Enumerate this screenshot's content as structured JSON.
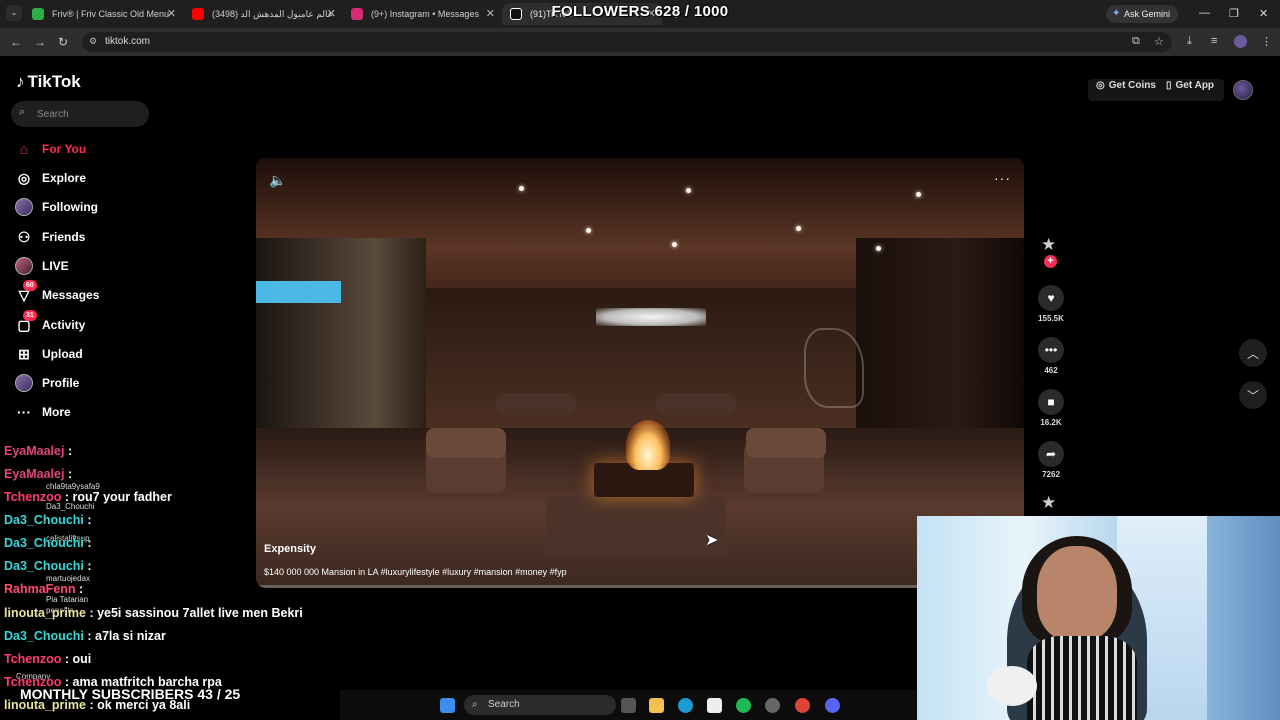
{
  "browser": {
    "tabs": [
      {
        "title": "Friv® | Friv Classic Old Menu",
        "close": "✕",
        "color": "#2fae46"
      },
      {
        "title": "عالم عاميول المدهش الد (3498)",
        "close": "✕",
        "color": "#ff0000"
      },
      {
        "title": "(9+) Instagram • Messages",
        "close": "✕",
        "color": "#d62976"
      },
      {
        "title": "(91)TikTok",
        "close": "✕",
        "color": "#ffffff"
      }
    ],
    "new_tab": "+",
    "ask_gemini": "Ask Gemini",
    "url": "tiktok.com"
  },
  "overlay": {
    "followers": "FOLLOWERS 628 / 1000",
    "monthly_subs": "MONTHLY SUBSCRIBERS 43 / 25"
  },
  "tiktok": {
    "logo": "TikTok",
    "search_placeholder": "Search",
    "menu": [
      {
        "label": "For You",
        "icon": "home-icon",
        "glyph": "⌂"
      },
      {
        "label": "Explore",
        "icon": "compass-icon",
        "glyph": "◎"
      },
      {
        "label": "Following",
        "icon": "following-avatar-icon",
        "glyph": ""
      },
      {
        "label": "Friends",
        "icon": "friends-icon",
        "glyph": "👥"
      },
      {
        "label": "LIVE",
        "icon": "live-avatar-icon",
        "glyph": ""
      },
      {
        "label": "Messages",
        "icon": "messages-icon",
        "glyph": "▽",
        "badge": "60"
      },
      {
        "label": "Activity",
        "icon": "activity-icon",
        "glyph": "▢",
        "badge": "31"
      },
      {
        "label": "Upload",
        "icon": "upload-icon",
        "glyph": "⊞"
      },
      {
        "label": "Profile",
        "icon": "profile-avatar-icon",
        "glyph": ""
      },
      {
        "label": "More",
        "icon": "more-icon",
        "glyph": "···"
      }
    ],
    "get_coins": "Get Coins",
    "get_app": "Get App",
    "video": {
      "author": "Expensity",
      "caption": "$140 000 000 Mansion in LA #luxurylifestyle #luxury #mansion #money #fyp",
      "progress": 0.0
    },
    "actions": {
      "likes": "155.5K",
      "comments": "462",
      "saves": "16.2K",
      "shares": "7262"
    }
  },
  "chat": [
    {
      "user": "EyaMaalej",
      "msg": " : ",
      "color": "#e0457b"
    },
    {
      "user": "EyaMaalej",
      "msg": " : ",
      "color": "#e0457b"
    },
    {
      "user": "Tchenzoo",
      "msg": " : rou7 your fadher",
      "color": "#ff3c6e"
    },
    {
      "user": "Da3_Chouchi",
      "msg": " : ",
      "color": "#35d7d7"
    },
    {
      "user": "Da3_Chouchi",
      "msg": " : ",
      "color": "#35d7d7"
    },
    {
      "user": "Da3_Chouchi",
      "msg": " : ",
      "color": "#35d7d7"
    },
    {
      "user": "RahmaFenn",
      "msg": " : ",
      "color": "#ff4d6d"
    },
    {
      "user": "linouta_prime",
      "msg": " : ye5i sassinou 7allet live men Bekri",
      "color": "#e8e4a0"
    },
    {
      "user": "Da3_Chouchi",
      "msg": " : a7la si nizar",
      "color": "#35d7d7"
    },
    {
      "user": "Tchenzoo",
      "msg": " : oui",
      "color": "#ff3c6e"
    },
    {
      "user": "Tchenzoo",
      "msg": " : ama matfritch barcha rpa",
      "color": "#ff3c6e"
    },
    {
      "user": "linouta_prime",
      "msg": " : ok merci ya 8ali",
      "color": "#e8e4a0"
    }
  ],
  "ghost_accounts": [
    "chla9ta9ysafa9",
    "Da3_Chouchi",
    "calistaliftsup",
    "martuojedax",
    "Pia Tatarian",
    "pensifts",
    "Company"
  ],
  "taskbar": {
    "search": "Search"
  }
}
